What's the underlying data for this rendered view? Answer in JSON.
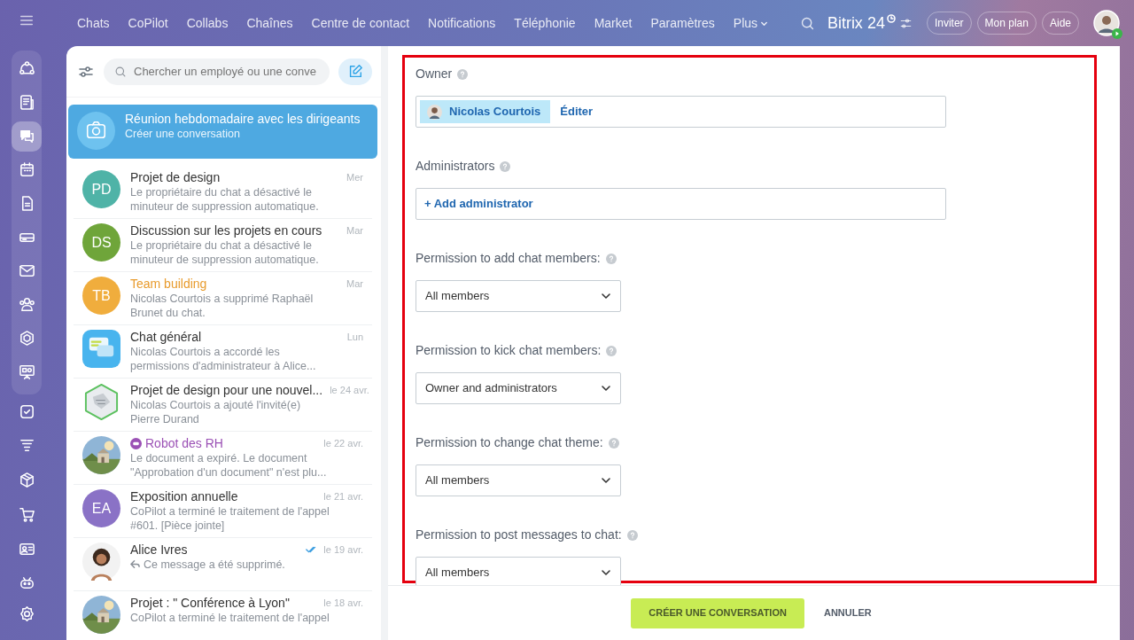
{
  "rail": [
    {
      "kind": "flow",
      "selected": false
    },
    {
      "kind": "news",
      "selected": false
    },
    {
      "kind": "chat",
      "selected": true
    },
    {
      "kind": "calendar",
      "selected": false
    },
    {
      "kind": "doc",
      "selected": false
    },
    {
      "kind": "drive",
      "selected": false
    },
    {
      "kind": "mail",
      "selected": false
    },
    {
      "kind": "people",
      "selected": false
    },
    {
      "kind": "hexagon",
      "selected": false
    },
    {
      "kind": "board",
      "selected": false
    },
    {
      "kind": "task",
      "selected": false
    },
    {
      "kind": "funnel",
      "selected": false
    },
    {
      "kind": "box",
      "selected": false
    },
    {
      "kind": "cart",
      "selected": false
    },
    {
      "kind": "card",
      "selected": false
    },
    {
      "kind": "robot",
      "selected": false
    }
  ],
  "top_nav": {
    "items": [
      {
        "label": "Chats",
        "dropdown": false
      },
      {
        "label": "CoPilot",
        "dropdown": false
      },
      {
        "label": "Collabs",
        "dropdown": false
      },
      {
        "label": "Chaînes",
        "dropdown": false
      },
      {
        "label": "Centre de contact",
        "dropdown": false
      },
      {
        "label": "Notifications",
        "dropdown": false
      },
      {
        "label": "Téléphonie",
        "dropdown": false
      },
      {
        "label": "Market",
        "dropdown": false
      },
      {
        "label": "Paramètres",
        "dropdown": false
      },
      {
        "label": "Plus",
        "dropdown": true
      }
    ],
    "logo": "Bitrix 24",
    "buttons": [
      "Inviter",
      "Mon plan",
      "Aide"
    ]
  },
  "chat_list": {
    "search_placeholder": "Chercher un employé ou une conve",
    "chats": [
      {
        "title": "Réunion hebdomadaire avec les dirigeants",
        "preview": "Créer une conversation",
        "selected": true,
        "avatar": {
          "kind": "camera"
        }
      },
      {
        "title": "Projet de design",
        "preview": "Le propriétaire du chat a désactivé le minuteur de suppression automatique.",
        "time": "Mer",
        "selected": false,
        "avatar": {
          "kind": "initials",
          "initials": "PD",
          "color": "#4fb3a7"
        }
      },
      {
        "title": "Discussion sur les projets en cours",
        "preview": "Le propriétaire du chat a désactivé le minuteur de suppression automatique.",
        "time": "Mar",
        "selected": false,
        "avatar": {
          "kind": "initials",
          "initials": "DS",
          "color": "#6fa53a"
        }
      },
      {
        "title": "Team building",
        "color": "#e89b2c",
        "preview": "Nicolas Courtois a supprimé Raphaël Brunet du chat.",
        "time": "Mar",
        "selected": false,
        "avatar": {
          "kind": "initials",
          "initials": "TB",
          "color": "#f0ad3d"
        }
      },
      {
        "title": "Chat général",
        "preview": "Nicolas Courtois a accordé les permissions d'administrateur à Alice...",
        "time": "Lun",
        "selected": false,
        "avatar": {
          "kind": "bubbles"
        }
      },
      {
        "title": "Projet de design pour une nouvel...",
        "preview": "Nicolas Courtois a ajouté l'invité(e) Pierre Durand",
        "time": "le 24 avr.",
        "selected": false,
        "avatar": {
          "kind": "hexagon-picture"
        }
      },
      {
        "title": "Robot des RH",
        "color": "#9b51b5",
        "bot": true,
        "preview": "Le document a expiré. Le document \"Approbation d'un document\" n'est plu...",
        "time": "le 22 avr.",
        "selected": false
      },
      {
        "title": "Exposition annuelle",
        "preview": "CoPilot a terminé le traitement de l'appel #601. [Pièce jointe]",
        "time": "le 21 avr.",
        "selected": false,
        "avatar": {
          "kind": "initials",
          "initials": "EA",
          "color": "#8a72c6"
        }
      },
      {
        "title": "Alice Ivres",
        "preview": "Ce message a été supprimé.",
        "reply": true,
        "read": true,
        "time": "le 19 avr.",
        "selected": false,
        "avatar": {
          "kind": "person"
        }
      },
      {
        "title": "Projet : \" Conférence à Lyon\"",
        "preview": "CoPilot a terminé le traitement de l'appel",
        "time": "le 18 avr.",
        "selected": false
      }
    ]
  },
  "form": {
    "highlighted": true,
    "owner": {
      "label": "Owner",
      "name": "Nicolas Courtois",
      "edit": "Éditer"
    },
    "administrators": {
      "label": "Administrators",
      "add": "+ Add administrator"
    },
    "permissions": [
      {
        "label": "Permission to add chat members:",
        "value": "All members"
      },
      {
        "label": "Permission to kick chat members:",
        "value": "Owner and administrators"
      },
      {
        "label": "Permission to change chat theme:",
        "value": "All members"
      },
      {
        "label": "Permission to post messages to chat:",
        "value": "All members"
      }
    ]
  },
  "footer": {
    "primary": "CRÉER UNE CONVERSATION",
    "secondary": "ANNULER"
  }
}
